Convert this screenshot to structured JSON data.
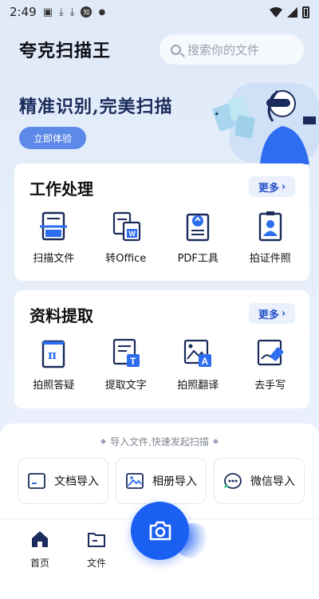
{
  "status_bar": {
    "time": "2:49",
    "icons": [
      "image-icon",
      "download-icon",
      "download-icon",
      "notification-badge-icon",
      "dot-icon"
    ],
    "badge_text": "知",
    "right_icons": [
      "wifi-icon",
      "signal-icon",
      "battery-icon"
    ]
  },
  "header": {
    "title": "夸克扫描王",
    "search_placeholder": "搜索你的文件"
  },
  "banner": {
    "slogan": "精准识别,完美扫描",
    "button_label": "立即体验"
  },
  "work_card": {
    "title": "工作处理",
    "more_label": "更多",
    "tools": [
      {
        "label": "扫描文件",
        "icon": "scan-document-icon"
      },
      {
        "label": "转Office",
        "icon": "convert-word-icon"
      },
      {
        "label": "PDF工具",
        "icon": "pdf-tool-icon"
      },
      {
        "label": "拍证件照",
        "icon": "id-photo-icon"
      }
    ]
  },
  "info_card": {
    "title": "资料提取",
    "more_label": "更多",
    "tools": [
      {
        "label": "拍照答疑",
        "icon": "pi-question-icon"
      },
      {
        "label": "提取文字",
        "icon": "extract-text-icon"
      },
      {
        "label": "拍照翻译",
        "icon": "photo-translate-icon"
      },
      {
        "label": "去手写",
        "icon": "erase-handwriting-icon"
      }
    ]
  },
  "import_sheet": {
    "hint": "导入文件,快速发起扫描",
    "buttons": [
      {
        "label": "文档导入",
        "icon": "document-import-icon"
      },
      {
        "label": "相册导入",
        "icon": "album-import-icon"
      },
      {
        "label": "微信导入",
        "icon": "wechat-import-icon"
      }
    ]
  },
  "bottom_nav": {
    "home_label": "首页",
    "files_label": "文件"
  },
  "colors": {
    "accent": "#1b5ff2",
    "more_text": "#2450c8",
    "slogan": "#1b2c5c",
    "try_button": "#5d8ae8"
  }
}
